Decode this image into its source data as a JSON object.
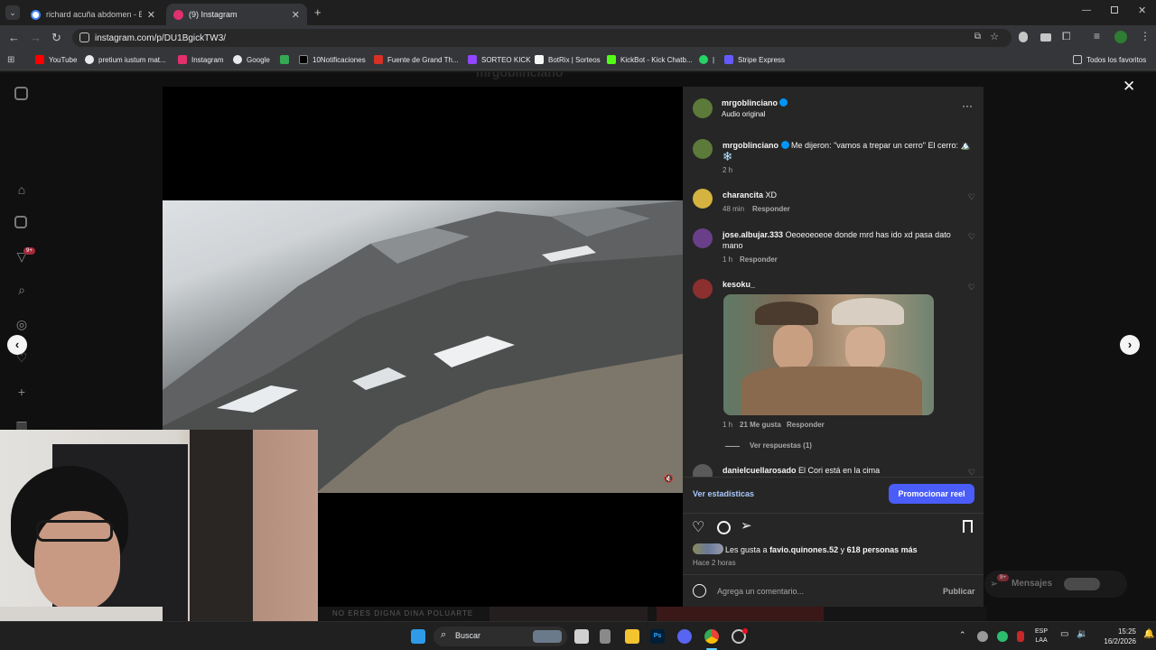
{
  "browser": {
    "tabs": [
      {
        "title": "richard acuña abdomen - Busca",
        "favicon_color": "#4285f4"
      },
      {
        "title": "(9) Instagram",
        "favicon_color": "#e1306c"
      }
    ],
    "url": "instagram.com/p/DU1BgickTW3/",
    "bookmarks": [
      {
        "label": "YouTube",
        "color": "#ff0000"
      },
      {
        "label": "pretium iustum mat...",
        "color": "#4285f4"
      },
      {
        "label": "Instagram",
        "color": "#e1306c"
      },
      {
        "label": "Google",
        "color": "#4285f4"
      },
      {
        "label": "",
        "color": "#34a853"
      },
      {
        "label": "10Notificaciones",
        "color": "#000000"
      },
      {
        "label": "Fuente de Grand Th...",
        "color": "#d93025"
      },
      {
        "label": "SORTEO KICK",
        "color": "#9146ff"
      },
      {
        "label": "BotRix | Sorteos",
        "color": "#f5f5f5"
      },
      {
        "label": "KickBot - Kick Chatb...",
        "color": "#53fc18"
      },
      {
        "label": "|",
        "color": "#25d366"
      },
      {
        "label": "Stripe Express",
        "color": "#635bff"
      }
    ],
    "all_bookmarks": "Todos los favoritos"
  },
  "post": {
    "username": "mrgoblinciano",
    "audio": "Audio original",
    "caption_user": "mrgoblinciano",
    "caption": "Me dijeron: \"vamos a trepar un cerro\" El cerro: 🏔️ ❄️",
    "caption_time": "2 h",
    "comments": [
      {
        "user": "charancita",
        "text": "XD",
        "time": "48 min",
        "reply": "Responder",
        "avatar_color": "#d4b340"
      },
      {
        "user": "jose.albujar.333",
        "text": "Oeoeoeoeoe donde mrd has ido xd pasa dato mano",
        "time": "1 h",
        "reply": "Responder",
        "avatar_color": "#6a3f8a"
      },
      {
        "user": "kesoku_",
        "text": "",
        "time": "1 h",
        "likes": "21 Me gusta",
        "reply": "Responder",
        "view_replies": "Ver respuestas (1)",
        "avatar_color": "#8c2f2f"
      },
      {
        "user": "danielcuellarosado",
        "text": "El Cori está en la cima",
        "avatar_color": "#5a5a5a"
      }
    ],
    "stats_link": "Ver estadísticas",
    "promote_button": "Promocionar reel",
    "likes_prefix": "Les gusta a",
    "likes_user": "favio.quinones.52",
    "likes_conj": "y",
    "likes_rest": "618 personas más",
    "posted_ago": "Hace 2 horas",
    "comment_placeholder": "Agrega un comentario...",
    "publish": "Publicar"
  },
  "background": {
    "messages": "Mensajes",
    "notif_badge": "9+",
    "bottom_text": "NO ERES DIGNA DINA POLUARTE",
    "header_user": "mrgoblinciano"
  },
  "taskbar": {
    "search": "Buscar",
    "lang": "ESP",
    "lang2": "LAA",
    "time": "15:25",
    "date": "16/2/2026"
  }
}
